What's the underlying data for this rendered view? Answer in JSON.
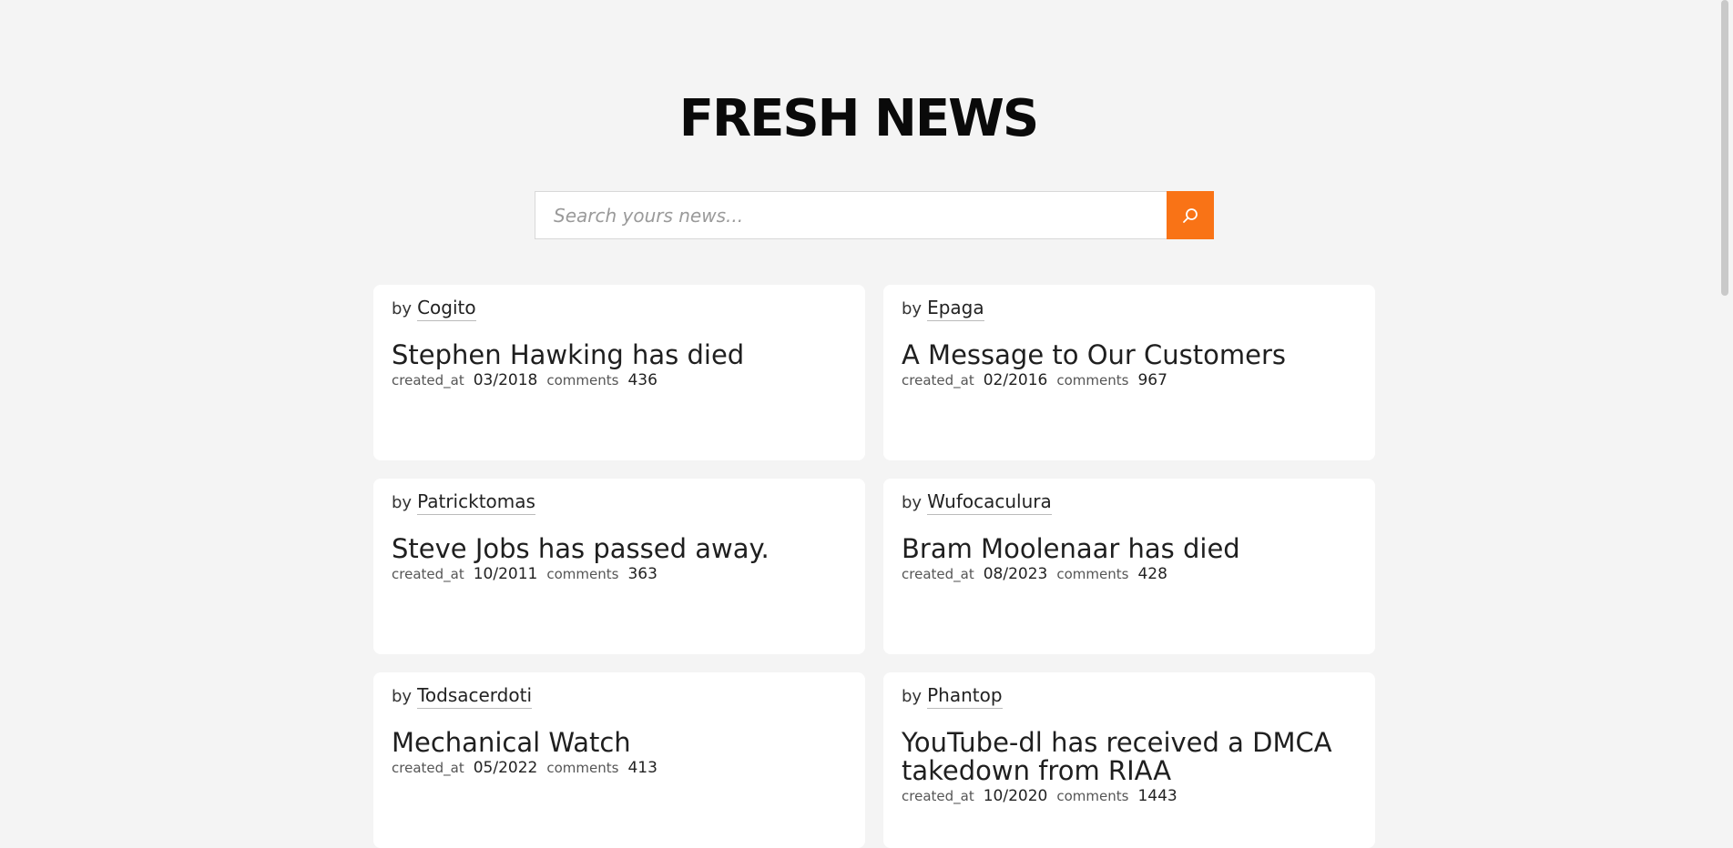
{
  "header": {
    "title": "FRESH NEWS"
  },
  "search": {
    "placeholder": "Search yours news...",
    "value": "",
    "button_icon": "search-icon",
    "button_color": "#f97316"
  },
  "labels": {
    "by": "by",
    "created_at": "created_at",
    "comments": "comments"
  },
  "news": [
    {
      "author": "Cogito",
      "title": "Stephen Hawking has died",
      "created_at": "03/2018",
      "comments": "436"
    },
    {
      "author": "Epaga",
      "title": "A Message to Our Customers",
      "created_at": "02/2016",
      "comments": "967"
    },
    {
      "author": "Patricktomas",
      "title": "Steve Jobs has passed away.",
      "created_at": "10/2011",
      "comments": "363"
    },
    {
      "author": "Wufocaculura",
      "title": "Bram Moolenaar has died",
      "created_at": "08/2023",
      "comments": "428"
    },
    {
      "author": "Todsacerdoti",
      "title": "Mechanical Watch",
      "created_at": "05/2022",
      "comments": "413"
    },
    {
      "author": "Phantop",
      "title": "YouTube-dl has received a DMCA takedown from RIAA",
      "created_at": "10/2020",
      "comments": "1443"
    }
  ]
}
